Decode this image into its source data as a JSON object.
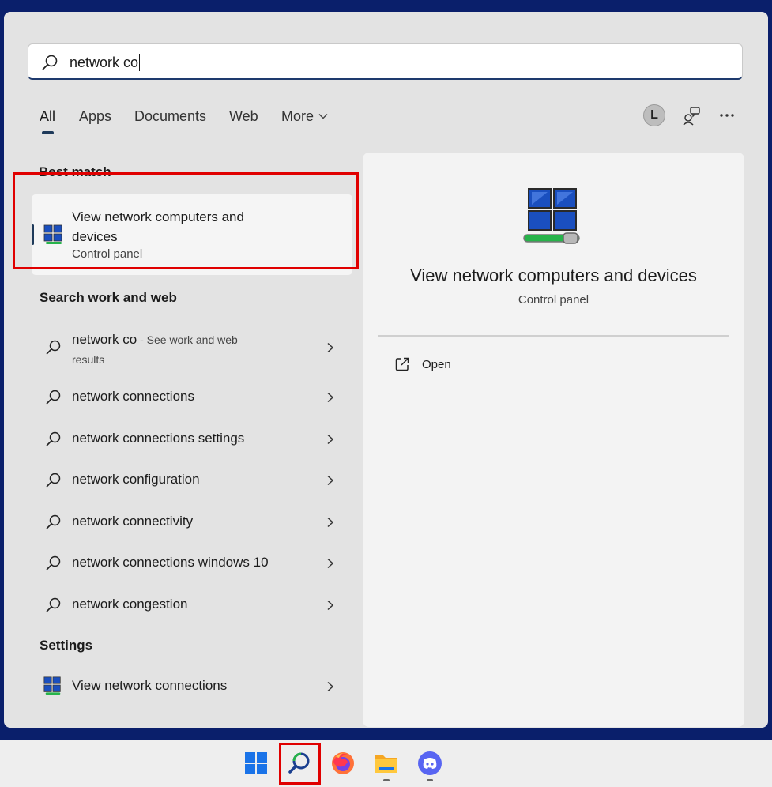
{
  "search": {
    "query": "network co"
  },
  "tabs": [
    {
      "label": "All"
    },
    {
      "label": "Apps"
    },
    {
      "label": "Documents"
    },
    {
      "label": "Web"
    },
    {
      "label": "More"
    }
  ],
  "account": {
    "initial": "L"
  },
  "sections": {
    "best_match": "Best match",
    "search_work_web": "Search work and web",
    "settings": "Settings"
  },
  "best_match": {
    "title": "View network computers and devices",
    "subtitle": "Control panel"
  },
  "web_results": {
    "first": {
      "query": "network co",
      "suffix": " - See work and web results"
    },
    "items": [
      "network connections",
      "network connections settings",
      "network configuration",
      "network connectivity",
      "network connections windows 10",
      "network congestion"
    ]
  },
  "settings_items": [
    "View network connections"
  ],
  "preview": {
    "title": "View network computers and devices",
    "subtitle": "Control panel",
    "open_label": "Open"
  },
  "icons": {
    "search": "search-icon",
    "network": "network-computers-icon",
    "open": "open-external-icon",
    "more": "ellipsis-icon",
    "feedback": "feedback-icon"
  },
  "colors": {
    "accent": "#1e3a5a",
    "highlight": "#e00000",
    "desktop": "#0a1f6b"
  }
}
